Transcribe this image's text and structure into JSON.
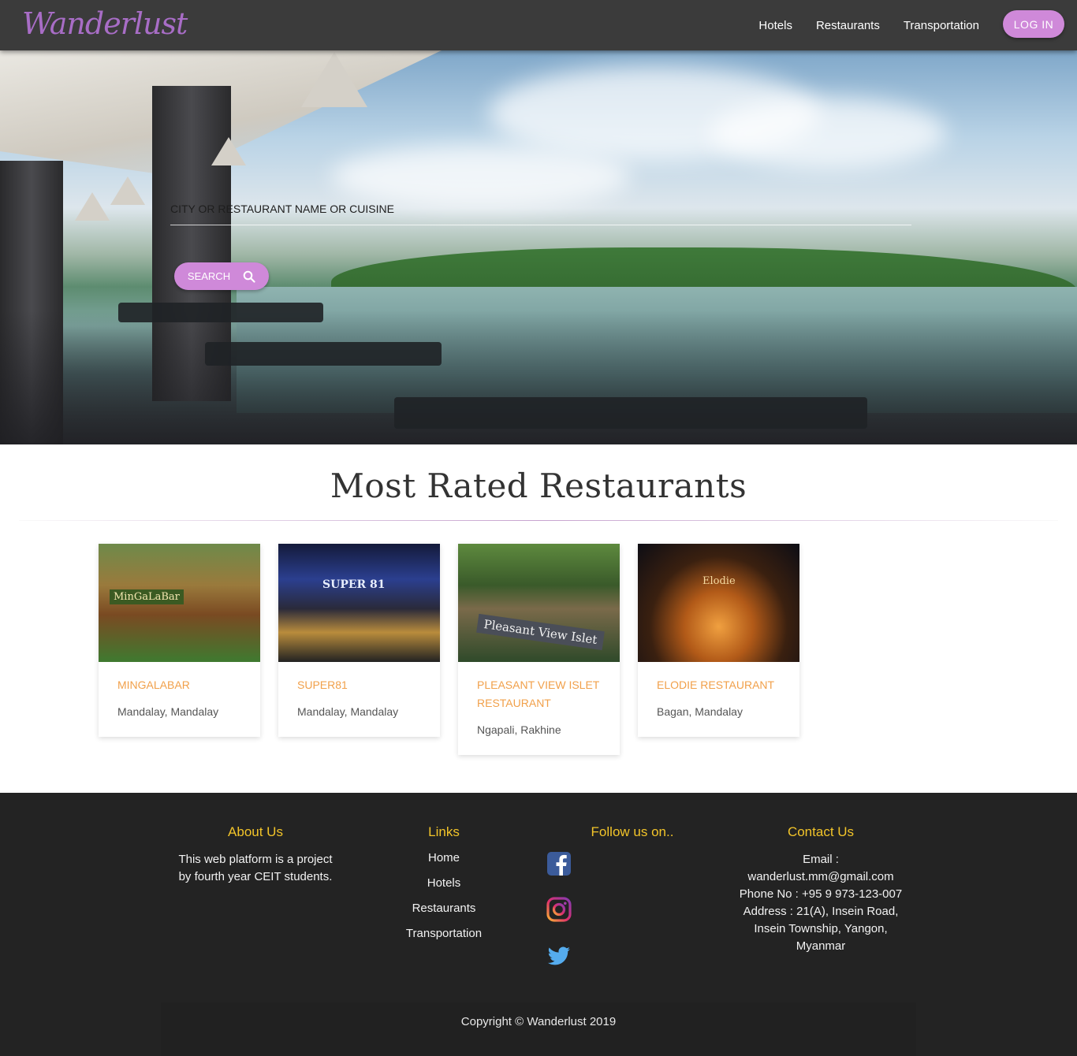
{
  "brand": {
    "logo_text": "Wanderlust",
    "accent_color": "#cf89d9"
  },
  "nav": {
    "links": [
      "Hotels",
      "Restaurants",
      "Transportation"
    ],
    "login_label": "LOG IN"
  },
  "hero": {
    "search_placeholder": "CITY OR RESTAURANT NAME OR CUISINE",
    "search_button_label": "SEARCH",
    "search_icon": "search-icon"
  },
  "section": {
    "title": "Most Rated Restaurants"
  },
  "restaurants": [
    {
      "name": "MINGALABAR",
      "location": "Mandalay, Mandalay",
      "sign": "MinGaLaBar"
    },
    {
      "name": "SUPER81",
      "location": "Mandalay, Mandalay",
      "sign": "SUPER 81"
    },
    {
      "name": "PLEASANT VIEW ISLET RESTAURANT",
      "location": "Ngapali, Rakhine",
      "sign": "Pleasant View Islet"
    },
    {
      "name": "ELODIE RESTAURANT",
      "location": "Bagan, Mandalay",
      "sign": "Elodie"
    }
  ],
  "footer": {
    "about": {
      "heading": "About Us",
      "text_line1": "This web platform is a project",
      "text_line2": "by fourth year CEIT students."
    },
    "links": {
      "heading": "Links",
      "items": [
        "Home",
        "Hotels",
        "Restaurants",
        "Transportation"
      ]
    },
    "follow": {
      "heading": "Follow us on..",
      "icons": [
        "facebook-icon",
        "instagram-icon",
        "twitter-icon"
      ]
    },
    "contact": {
      "heading": "Contact Us",
      "lines": [
        "Email :",
        "wanderlust.mm@gmail.com",
        "Phone No : +95 9 973-123-007",
        "Address : 21(A), Insein Road,",
        "Insein Township, Yangon,",
        "Myanmar"
      ]
    },
    "copyright": "Copyright © Wanderlust 2019",
    "heading_color": "#f2c429"
  }
}
